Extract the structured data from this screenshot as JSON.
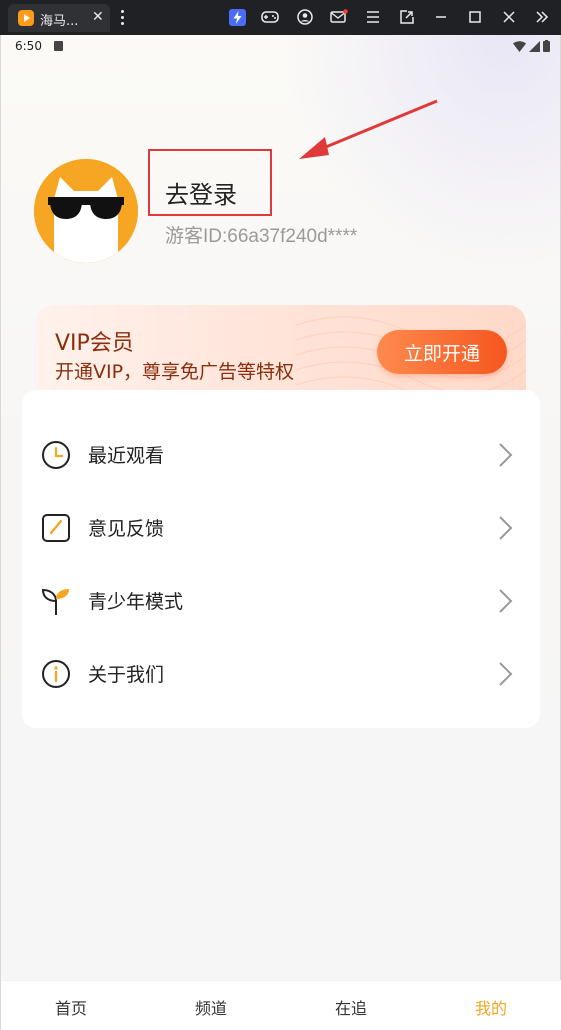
{
  "topbar": {
    "tab_title": "海马...",
    "tab_close": "✕"
  },
  "status": {
    "time": "6:50"
  },
  "profile": {
    "login_label": "去登录",
    "guest_id": "游客ID:66a37f240d****"
  },
  "vip": {
    "title": "VIP会员",
    "subtitle": "开通VIP，尊享免广告等特权",
    "button_label": "立即开通"
  },
  "menu": {
    "items": [
      {
        "label": "最近观看",
        "icon": "clock-icon"
      },
      {
        "label": "意见反馈",
        "icon": "edit-icon"
      },
      {
        "label": "青少年模式",
        "icon": "sprout-icon"
      },
      {
        "label": "关于我们",
        "icon": "info-icon"
      }
    ]
  },
  "nav": {
    "items": [
      {
        "label": "首页"
      },
      {
        "label": "频道"
      },
      {
        "label": "在追"
      },
      {
        "label": "我的",
        "active": true
      }
    ]
  },
  "colors": {
    "accent": "#f5a623",
    "vip_text": "#8b2e0c",
    "vip_button": "#f4571f",
    "highlight_box": "#e0393a"
  }
}
